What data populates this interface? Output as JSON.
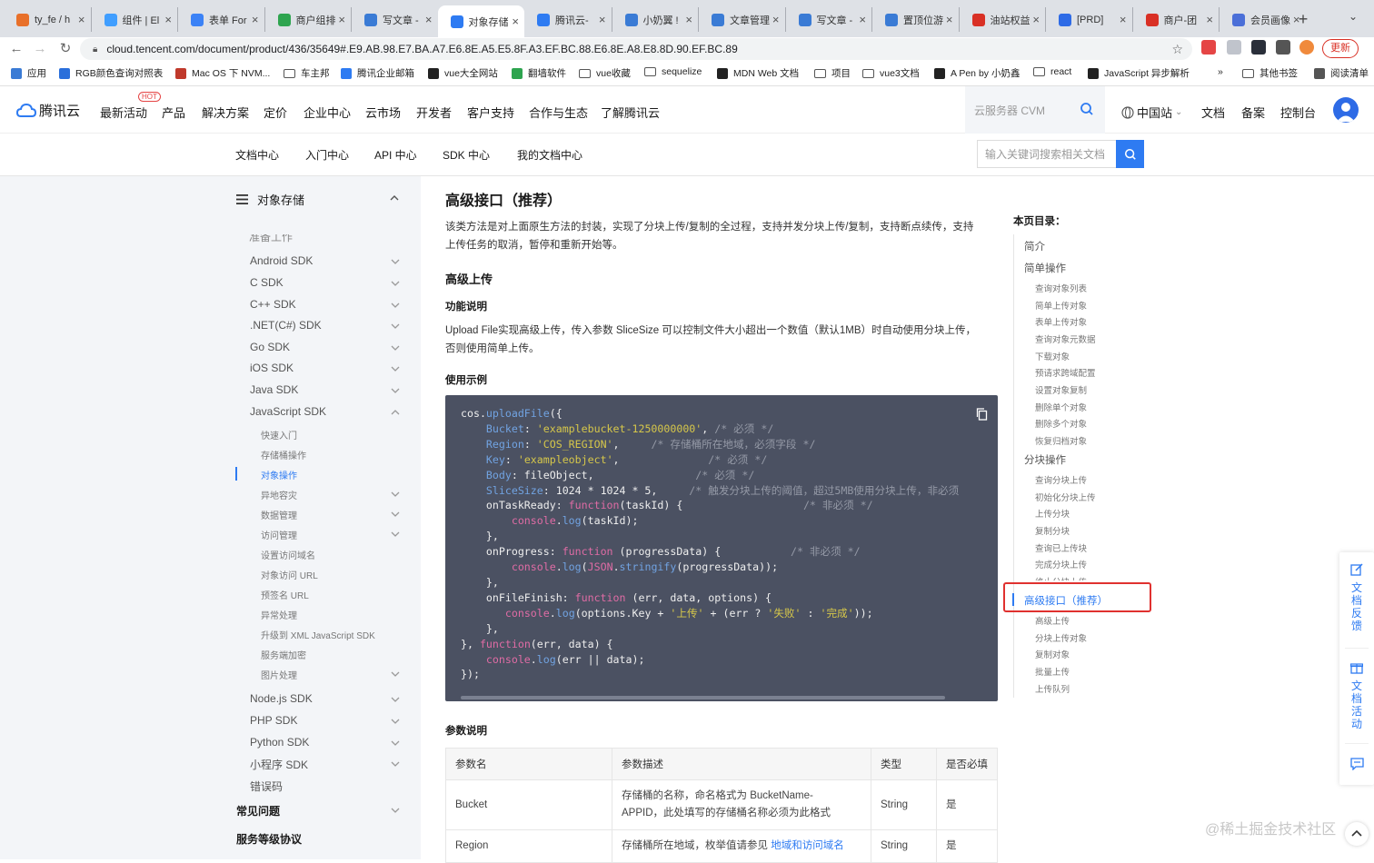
{
  "browser": {
    "tabs": [
      {
        "title": "ty_fe / h",
        "color": "#e8702a"
      },
      {
        "title": "组件 | El",
        "color": "#409eff"
      },
      {
        "title": "表单 For",
        "color": "#3b82f6"
      },
      {
        "title": "商户组排",
        "color": "#2ea44f"
      },
      {
        "title": "写文章 -",
        "color": "#3a7bd5"
      },
      {
        "title": "对象存储",
        "color": "#2e7bf2"
      },
      {
        "title": "腾讯云-",
        "color": "#2e7bf2"
      },
      {
        "title": "小奶翼 !",
        "color": "#3a7bd5"
      },
      {
        "title": "文章管理",
        "color": "#3a7bd5"
      },
      {
        "title": "写文章 -",
        "color": "#3a7bd5"
      },
      {
        "title": "置顶位游",
        "color": "#3a7bd5"
      },
      {
        "title": "油站权益",
        "color": "#d93025"
      },
      {
        "title": "[PRD]",
        "color": "#2e6be6"
      },
      {
        "title": "商户-团",
        "color": "#d93025"
      },
      {
        "title": "会员画像",
        "color": "#4b6fd8"
      }
    ],
    "active_tab_index": 5,
    "url": "cloud.tencent.com/document/product/436/35649#.E9.AB.98.E7.BA.A7.E6.8E.A5.E5.8F.A3.EF.BC.88.E6.8E.A8.E8.8D.90.EF.BC.89",
    "update_label": "更新",
    "bookmarks": [
      "应用",
      "RGB颜色查询对照表",
      "Mac OS 下 NVM...",
      "车主邦",
      "腾讯企业邮箱",
      "vue大全网站",
      "翻墙软件",
      "vue收藏",
      "sequelize",
      "MDN Web 文档",
      "项目",
      "vue3文档",
      "A Pen by 小奶鑫",
      "react",
      "JavaScript 异步解析",
      "»",
      "其他书签",
      "阅读清单"
    ]
  },
  "header": {
    "logo_text": "腾讯云",
    "hot_badge": "HOT",
    "nav": [
      "最新活动",
      "产品",
      "解决方案",
      "定价",
      "企业中心",
      "云市场",
      "开发者",
      "客户支持",
      "合作与生态",
      "了解腾讯云"
    ],
    "search_placeholder": "云服务器 CVM",
    "region": "中国站",
    "right_links": [
      "文档",
      "备案",
      "控制台"
    ]
  },
  "subnav": {
    "items": [
      "文档中心",
      "入门中心",
      "API 中心",
      "SDK 中心",
      "我的文档中心"
    ],
    "search_placeholder": "输入关键词搜索相关文档"
  },
  "sidebar": {
    "title": "对象存储",
    "partial_item": "准备工作",
    "items": [
      "Android SDK",
      "C SDK",
      "C++ SDK",
      ".NET(C#) SDK",
      "Go SDK",
      "iOS SDK",
      "Java SDK",
      "JavaScript SDK"
    ],
    "js_sub": [
      "快速入门",
      "存储桶操作",
      "对象操作",
      "异地容灾",
      "数据管理",
      "访问管理",
      "设置访问域名",
      "对象访问 URL",
      "预签名 URL",
      "异常处理",
      "升级到 XML JavaScript SDK",
      "服务端加密",
      "图片处理"
    ],
    "items_after": [
      "Node.js SDK",
      "PHP SDK",
      "Python SDK",
      "小程序 SDK",
      "错误码"
    ],
    "sections": [
      "常见问题",
      "服务等级协议"
    ]
  },
  "content": {
    "title": "高级接口（推荐）",
    "intro_l1": "该类方法是对上面原生方法的封装，实现了分块上传/复制的全过程，支持并发分块上传/复制，支持断点续传，支持",
    "intro_l2": "上传任务的取消，暂停和重新开始等。",
    "h_upload": "高级上传",
    "h_func": "功能说明",
    "func_l1": "Upload File实现高级上传，传入参数 SliceSize 可以控制文件大小超出一个数值（默认1MB）时自动使用分块上传，",
    "func_l2": "否则使用简单上传。",
    "h_example": "使用示例",
    "h_params": "参数说明",
    "table": {
      "headers": [
        "参数名",
        "参数描述",
        "类型",
        "是否必填"
      ],
      "rows": [
        {
          "name": "Bucket",
          "desc1": "存储桶的名称，命名格式为 BucketName-",
          "desc2": "APPID，此处填写的存储桶名称必须为此格式",
          "type": "String",
          "required": "是"
        },
        {
          "name": "Region",
          "desc1": "存储桶所在地域，枚举值请参见",
          "link": "地域和访问域名",
          "type": "String",
          "required": "是"
        }
      ]
    }
  },
  "toc": {
    "title": "本页目录：",
    "entries": [
      {
        "text": "简介",
        "level": 1
      },
      {
        "text": "简单操作",
        "level": 1
      },
      {
        "text": "查询对象列表",
        "level": 2
      },
      {
        "text": "简单上传对象",
        "level": 2
      },
      {
        "text": "表单上传对象",
        "level": 2
      },
      {
        "text": "查询对象元数据",
        "level": 2
      },
      {
        "text": "下载对象",
        "level": 2
      },
      {
        "text": "预请求跨域配置",
        "level": 2
      },
      {
        "text": "设置对象复制",
        "level": 2
      },
      {
        "text": "删除单个对象",
        "level": 2
      },
      {
        "text": "删除多个对象",
        "level": 2
      },
      {
        "text": "恢复归档对象",
        "level": 2
      },
      {
        "text": "分块操作",
        "level": 1
      },
      {
        "text": "查询分块上传",
        "level": 2
      },
      {
        "text": "初始化分块上传",
        "level": 2
      },
      {
        "text": "上传分块",
        "level": 2
      },
      {
        "text": "复制分块",
        "level": 2
      },
      {
        "text": "查询已上传块",
        "level": 2
      },
      {
        "text": "完成分块上传",
        "level": 2
      },
      {
        "text": "终止分块上传",
        "level": 2
      },
      {
        "text": "高级接口（推荐）",
        "level": 1,
        "active": true
      },
      {
        "text": "高级上传",
        "level": 2
      },
      {
        "text": "分块上传对象",
        "level": 2
      },
      {
        "text": "复制对象",
        "level": 2
      },
      {
        "text": "批量上传",
        "level": 2
      },
      {
        "text": "上传队列",
        "level": 2
      }
    ]
  },
  "float": {
    "feedback": "文档反馈",
    "activity": "文档活动"
  },
  "watermark": "@稀土掘金技术社区",
  "colors": {
    "accent": "#2e7bf2",
    "code_bg": "#4b5162",
    "highlight_border": "#e0312f"
  }
}
